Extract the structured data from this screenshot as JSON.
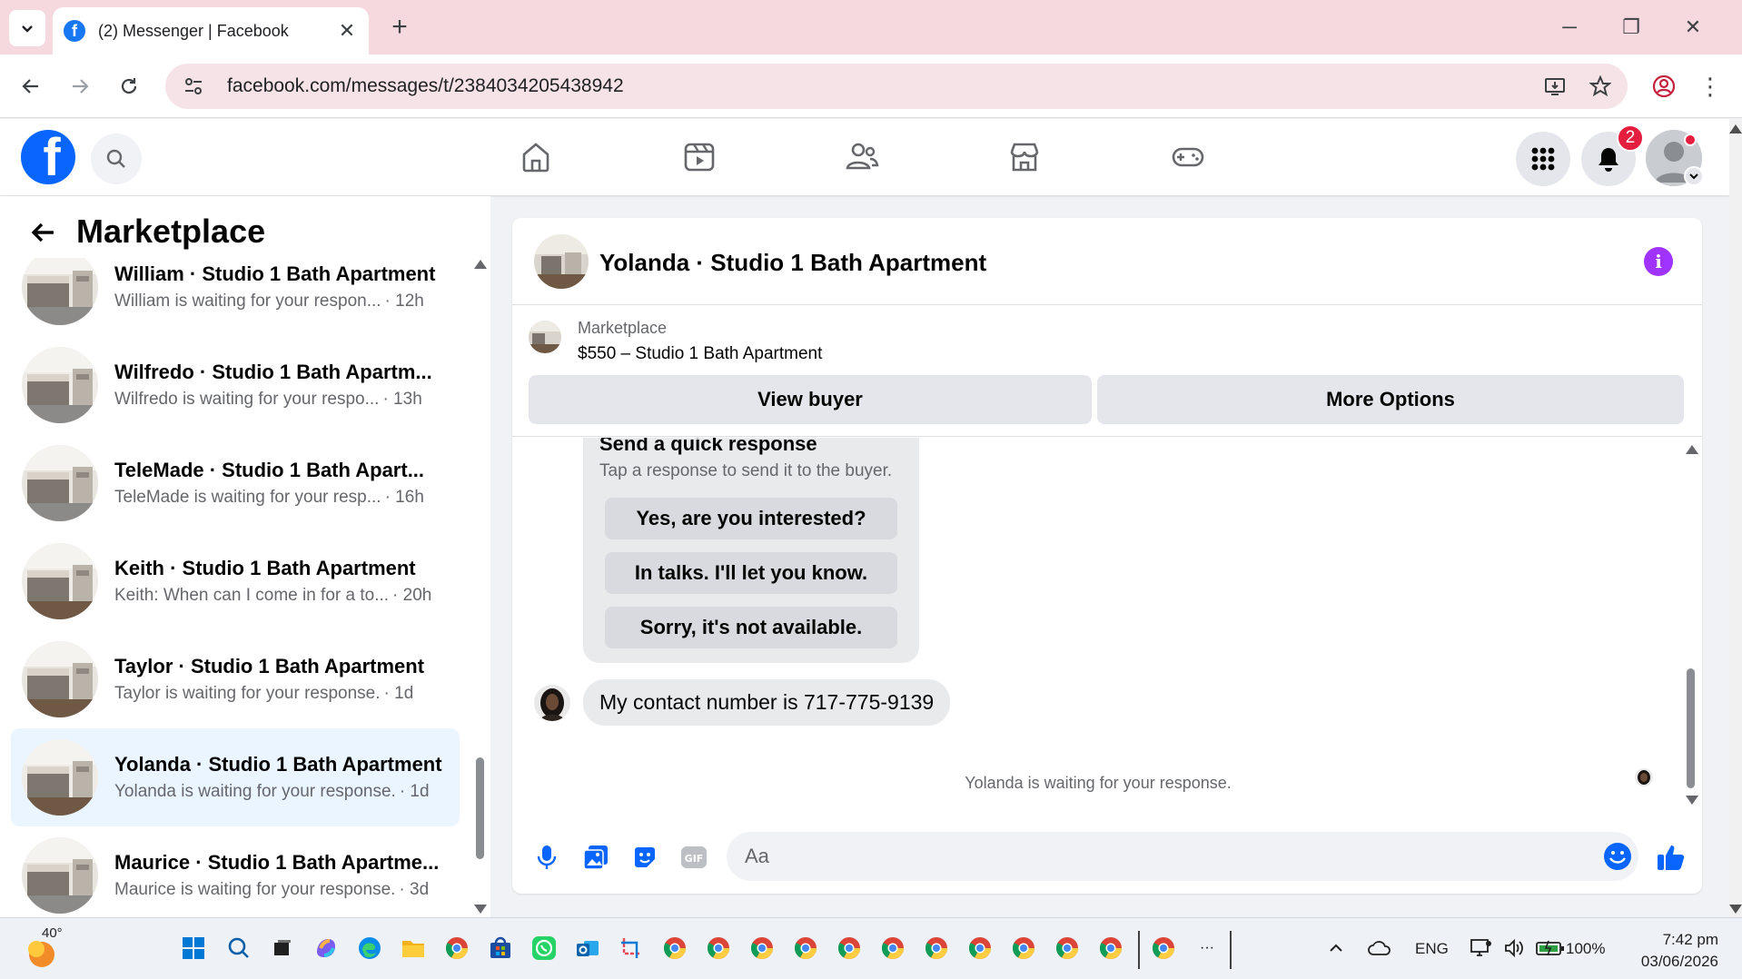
{
  "browser": {
    "tab_title": "(2) Messenger | Facebook",
    "tab_close": "✕",
    "new_tab": "+",
    "url": "facebook.com/messages/t/2384034205438942",
    "minimize": "─",
    "restore": "❐",
    "close": "✕"
  },
  "fb": {
    "notifications_count": "2"
  },
  "sidebar": {
    "title": "Marketplace",
    "conversations": [
      {
        "name": "William · Studio 1 Bath Apartment",
        "preview": "William is waiting for your respon...",
        "time": "· 12h",
        "active": false
      },
      {
        "name": "Wilfredo · Studio 1 Bath Apartm...",
        "preview": "Wilfredo is waiting for your respo...",
        "time": "· 13h",
        "active": false
      },
      {
        "name": "TeleMade · Studio 1 Bath Apart...",
        "preview": "TeleMade is waiting for your resp...",
        "time": "· 16h",
        "active": false
      },
      {
        "name": "Keith · Studio 1 Bath Apartment",
        "preview": "Keith: When can I come in for a to...",
        "time": "· 20h",
        "active": false
      },
      {
        "name": "Taylor · Studio 1 Bath Apartment",
        "preview": "Taylor is waiting for your response.",
        "time": "· 1d",
        "active": false
      },
      {
        "name": "Yolanda · Studio 1 Bath Apartment",
        "preview": "Yolanda is waiting for your response.",
        "time": "· 1d",
        "active": true
      },
      {
        "name": "Maurice · Studio 1 Bath Apartme...",
        "preview": "Maurice is waiting for your response.",
        "time": "· 3d",
        "active": false
      }
    ]
  },
  "chat": {
    "title": "Yolanda · Studio 1 Bath Apartment",
    "info_icon": "i",
    "marketplace_label": "Marketplace",
    "listing": "$550 – Studio 1 Bath Apartment",
    "view_buyer": "View buyer",
    "more_options": "More Options",
    "quick_title": "Send a quick response",
    "quick_sub": "Tap a response to send it to the buyer.",
    "quick_responses": [
      "Yes, are you interested?",
      "In talks. I'll let you know.",
      "Sorry, it's not available."
    ],
    "message": "My contact number is 717-775-9139",
    "waiting": "Yolanda is waiting for your response.",
    "input_placeholder": "Aa"
  },
  "taskbar": {
    "weather": "40°",
    "language": "ENG",
    "battery": "100%",
    "time": "7:42 pm",
    "date": "03/06/2026",
    "more": "···"
  },
  "colors": {
    "fb_blue": "#0866ff",
    "active_row": "#ebf5ff",
    "badge_red": "#e41e3f",
    "info_purple": "#a033ff",
    "tab_strip": "#f6d8df"
  }
}
